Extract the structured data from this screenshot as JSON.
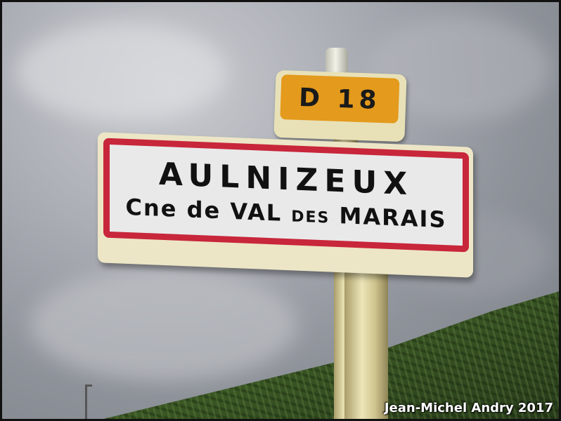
{
  "photo": {
    "route_sign": {
      "text": "D 18",
      "color": "#e49a1c"
    },
    "town_sign": {
      "name": "AULNIZEUX",
      "sub_prefix": "Cne de VAL",
      "sub_small": "DES",
      "sub_suffix": "MARAIS",
      "border_color": "#c8263a"
    },
    "credit": "Jean-Michel Andry 2017"
  }
}
